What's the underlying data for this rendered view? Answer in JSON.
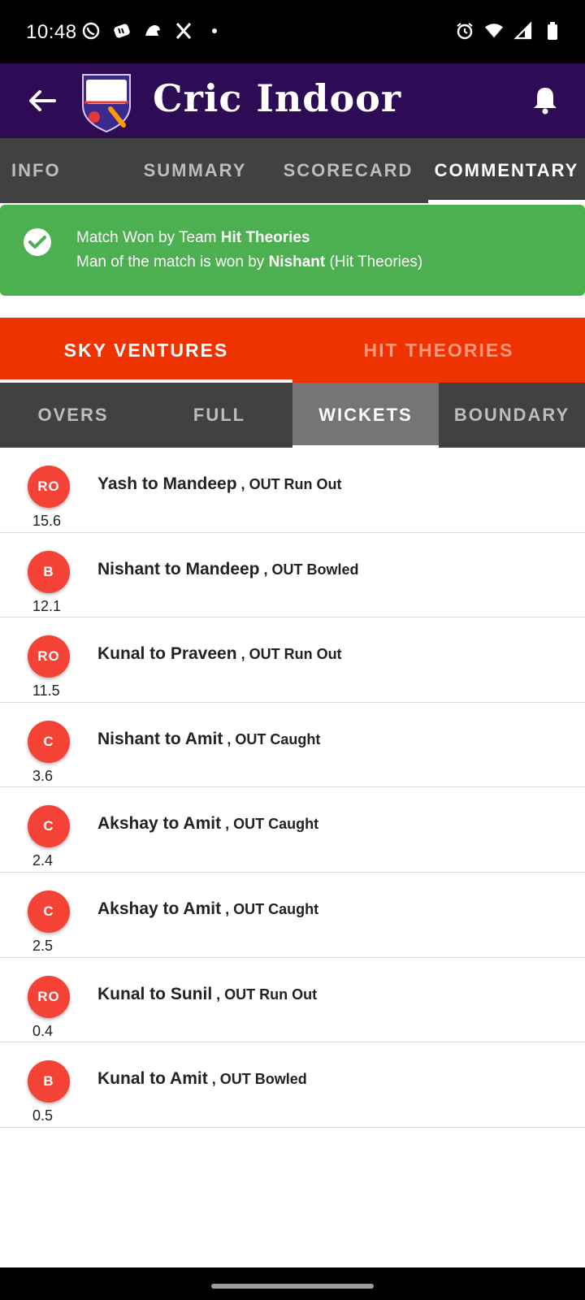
{
  "status_bar": {
    "time": "10:48",
    "left_icons": [
      "whatsapp-icon",
      "app-icon",
      "bird-icon",
      "x-icon",
      "dot-icon"
    ],
    "right_icons": [
      "alarm-icon",
      "wifi-icon",
      "signal-icon",
      "battery-icon"
    ]
  },
  "app_bar": {
    "logo_text": "CRIC INDOOR",
    "title": "Cric Indoor"
  },
  "top_tabs": [
    {
      "label": "INFO",
      "active": false
    },
    {
      "label": "SUMMARY",
      "active": false
    },
    {
      "label": "SCORECARD",
      "active": false
    },
    {
      "label": "COMMENTARY",
      "active": true
    }
  ],
  "result": {
    "line1_prefix": "Match Won by Team ",
    "winner": "Hit Theories",
    "line2_prefix": "Man of the match is won by ",
    "mom": "Nishant",
    "mom_team": " (Hit Theories)"
  },
  "team_tabs": [
    {
      "label": "SKY VENTURES",
      "active": true
    },
    {
      "label": "HIT THEORIES",
      "active": false
    }
  ],
  "filter_tabs": [
    {
      "label": "OVERS",
      "active": false
    },
    {
      "label": "FULL",
      "active": false
    },
    {
      "label": "WICKETS",
      "active": true
    },
    {
      "label": "BOUNDARY",
      "active": false
    }
  ],
  "wickets": [
    {
      "badge": "RO",
      "over": "15.6",
      "text": "Yash to Mandeep",
      "sep": " , ",
      "detail": "OUT Run Out"
    },
    {
      "badge": "B",
      "over": "12.1",
      "text": "Nishant to Mandeep",
      "sep": " , ",
      "detail": "OUT Bowled"
    },
    {
      "badge": "RO",
      "over": "11.5",
      "text": "Kunal to Praveen",
      "sep": " , ",
      "detail": "OUT Run Out"
    },
    {
      "badge": "C",
      "over": "3.6",
      "text": "Nishant to Amit",
      "sep": " , ",
      "detail": "OUT Caught"
    },
    {
      "badge": "C",
      "over": "2.4",
      "text": "Akshay to Amit",
      "sep": " , ",
      "detail": "OUT Caught"
    },
    {
      "badge": "C",
      "over": "2.5",
      "text": "Akshay to Amit",
      "sep": " , ",
      "detail": "OUT Caught"
    },
    {
      "badge": "RO",
      "over": "0.4",
      "text": "Kunal to Sunil",
      "sep": " , ",
      "detail": "OUT Run Out"
    },
    {
      "badge": "B",
      "over": "0.5",
      "text": "Kunal to Amit",
      "sep": " , ",
      "detail": "OUT Bowled"
    }
  ],
  "colors": {
    "app_bar": "#2d0b55",
    "tabs_bg": "#414141",
    "success": "#4caf50",
    "team_tabs_bg": "#ee3300",
    "badge": "#f44336"
  }
}
